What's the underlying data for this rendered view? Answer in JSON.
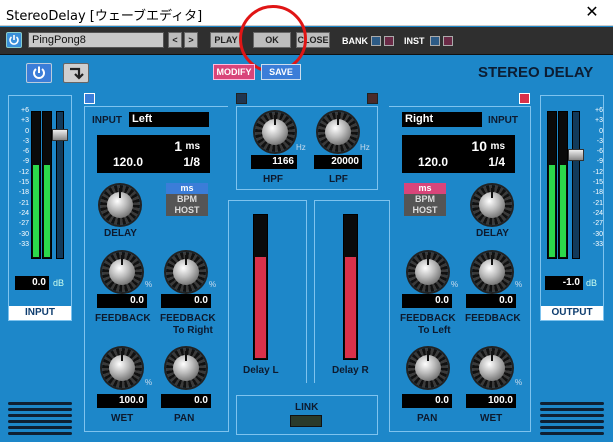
{
  "window": {
    "title": "StereoDelay [ウェーブエディタ]",
    "close_glyph": "✕"
  },
  "toolbar": {
    "preset_name": "PingPong8",
    "prev_glyph": "<",
    "next_glyph": ">",
    "play_label": "PLAY",
    "ok_label": "OK",
    "close_label": "CLOSE",
    "bank_label": "BANK",
    "inst_label": "INST"
  },
  "header": {
    "modify_label": "MODIFY",
    "save_label": "SAVE",
    "product_title": "STEREO DELAY"
  },
  "meters": {
    "scale": [
      "+6",
      "+3",
      "0",
      "-3",
      "-6",
      "-9",
      "-12",
      "-15",
      "-18",
      "-21",
      "-24",
      "-27",
      "-30",
      "-33"
    ],
    "input": {
      "label": "INPUT",
      "value": "0.0",
      "unit": "dB",
      "level_left": 0.63,
      "level_right": 0.63,
      "fader": 0.87
    },
    "output": {
      "label": "OUTPUT",
      "value": "-1.0",
      "unit": "dB",
      "level_left": 0.63,
      "level_right": 0.63,
      "fader": 0.72
    }
  },
  "left_channel": {
    "input_label": "INPUT",
    "input_value": "Left",
    "time_ms": "1",
    "time_unit": "ms",
    "tempo": "120.0",
    "note": "1/8",
    "unit_options": [
      "ms",
      "BPM",
      "HOST"
    ],
    "selected_unit": "ms",
    "delay_label": "DELAY",
    "feedback_value": "0.0",
    "feedback_label": "FEEDBACK",
    "feedback_cross_value": "0.0",
    "feedback_cross_label1": "FEEDBACK",
    "feedback_cross_label2": "To Right",
    "wet_value": "100.0",
    "wet_label": "WET",
    "pan_value": "0.0",
    "pan_label": "PAN",
    "percent": "%"
  },
  "right_channel": {
    "input_label": "INPUT",
    "input_value": "Right",
    "time_ms": "10",
    "time_unit": "ms",
    "tempo": "120.0",
    "note": "1/4",
    "unit_options": [
      "ms",
      "BPM",
      "HOST"
    ],
    "selected_unit": "ms",
    "delay_label": "DELAY",
    "feedback_cross_value": "0.0",
    "feedback_cross_label1": "FEEDBACK",
    "feedback_cross_label2": "To Left",
    "feedback_value": "0.0",
    "feedback_label": "FEEDBACK",
    "pan_value": "0.0",
    "pan_label": "PAN",
    "wet_value": "100.0",
    "wet_label": "WET",
    "percent": "%"
  },
  "filters": {
    "hpf_value": "1166",
    "hpf_label": "HPF",
    "lpf_value": "20000",
    "lpf_label": "LPF",
    "unit": "Hz"
  },
  "delay_meters": {
    "left_label": "Delay L",
    "right_label": "Delay R",
    "left_level": 0.7,
    "right_level": 0.7
  },
  "link": {
    "label": "LINK"
  },
  "colors": {
    "background": "#1d87c9",
    "accent_pink": "#d9457a",
    "accent_blue": "#3b7dd8",
    "meter_green": "#2cd84a",
    "delay_red": "#d9304a"
  }
}
